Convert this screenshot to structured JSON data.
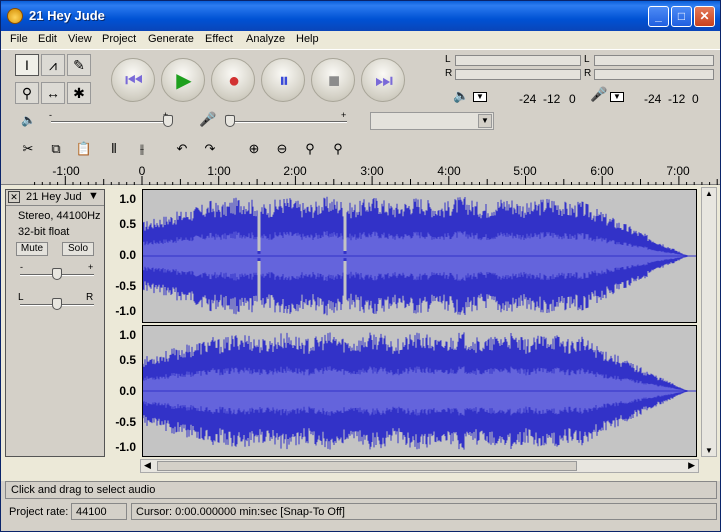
{
  "window": {
    "title": "21 Hey Jude"
  },
  "menu": [
    "File",
    "Edit",
    "View",
    "Project",
    "Generate",
    "Effect",
    "Analyze",
    "Help"
  ],
  "meters": {
    "left_label": "L",
    "right_label": "R",
    "scale": [
      "-24",
      "-12",
      "0"
    ]
  },
  "ruler": {
    "labels": [
      "-1:00",
      "0",
      "1:00",
      "2:00",
      "3:00",
      "4:00",
      "5:00",
      "6:00",
      "7:00"
    ]
  },
  "track": {
    "name": "21 Hey Jud",
    "info1": "Stereo, 44100Hz",
    "info2": "32-bit float",
    "mute": "Mute",
    "solo": "Solo",
    "gain_minus": "-",
    "gain_plus": "+",
    "pan_left": "L",
    "pan_right": "R",
    "scale": [
      "1.0",
      "0.5",
      "0.0",
      "-0.5",
      "-1.0"
    ]
  },
  "sliders": {
    "minus": "-",
    "plus": "+"
  },
  "status": {
    "message": "Click and drag to select audio",
    "rate_label": "Project rate:",
    "rate_value": "44100",
    "cursor": "Cursor: 0:00.000000 min:sec   [Snap-To Off]"
  },
  "colors": {
    "wave": "#3232c8",
    "wave_rms": "#6464dc",
    "wave_bg": "#c4c4c4"
  }
}
